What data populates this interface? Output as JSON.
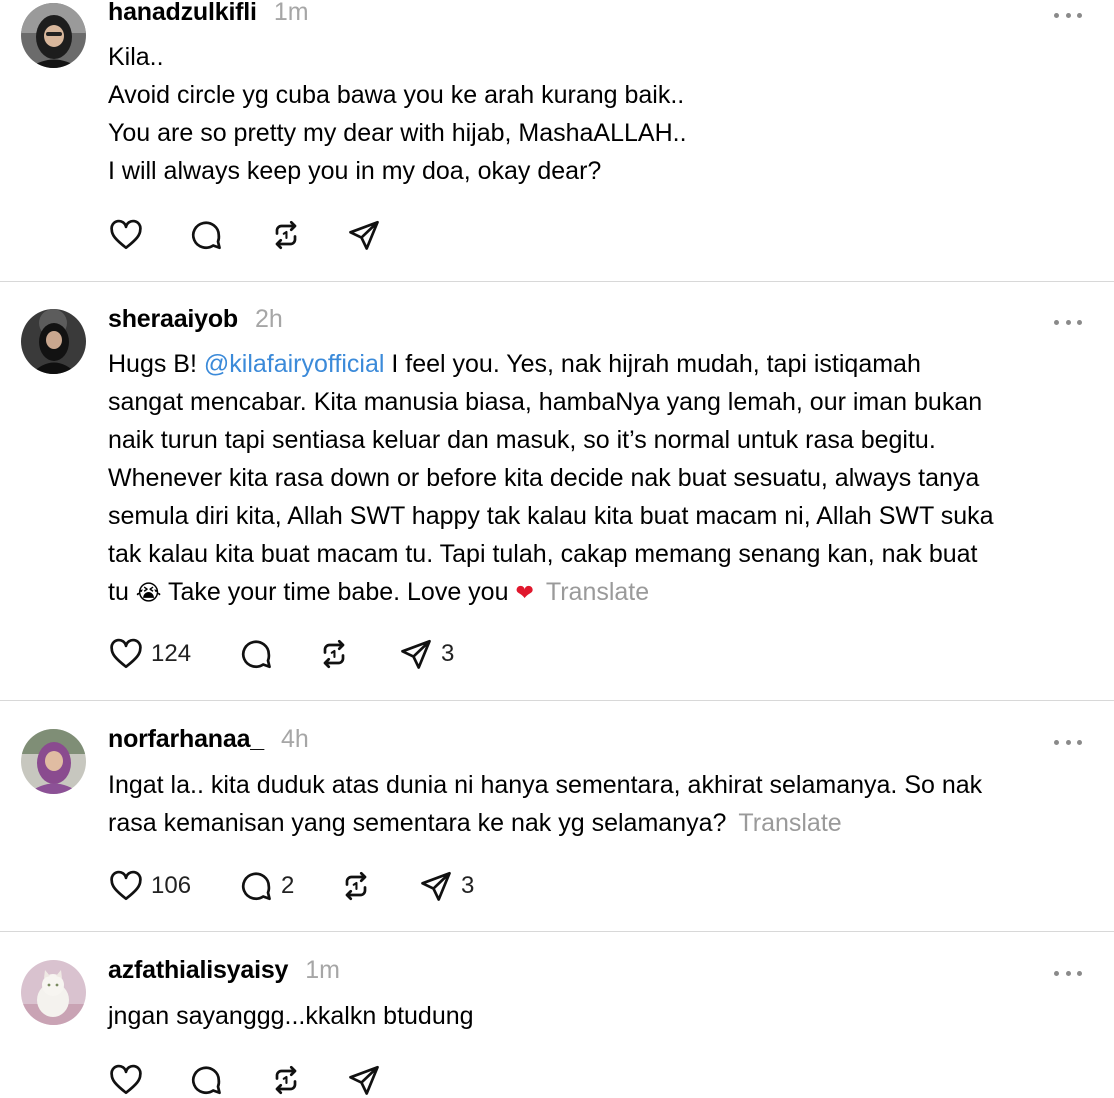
{
  "posts": [
    {
      "username": "hanadzulkifli",
      "time": "1m",
      "lines": [
        "Kila..",
        "Avoid circle yg cuba bawa you ke arah kurang baik..",
        "You are so pretty my dear with hijab, MashaALLAH..",
        "I will always keep you in my doa, okay dear?"
      ],
      "likes": "",
      "replies": "",
      "reposts": "",
      "shares": ""
    },
    {
      "username": "sheraaiyob",
      "time": "2h",
      "mention": "@kilafairyofficial",
      "line1_start": "Hugs B!",
      "line1_end": " I feel you. Yes, nak hijrah mudah, tapi istiqamah",
      "lines": [
        "sangat mencabar. Kita manusia biasa, hambaNya yang lemah, our iman bukan",
        "naik turun tapi sentiasa keluar dan masuk, so it’s normal untuk rasa begitu.",
        "Whenever kita rasa down or before kita decide nak buat sesuatu, always tanya",
        "semula diri kita, Allah SWT happy tak kalau kita buat macam ni, Allah SWT suka",
        "tak kalau kita buat macam tu. Tapi tulah, cakap memang senang kan, nak buat"
      ],
      "last_a": "tu ",
      "emoji_cry": "😭",
      "last_b": " Take your time babe. Love you ",
      "emoji_heart": "❤",
      "translate": "Translate",
      "likes": "124",
      "replies": "",
      "reposts": "",
      "shares": "3"
    },
    {
      "username": "norfarhanaa_",
      "time": "4h",
      "lines": [
        "Ingat la.. kita duduk atas dunia ni hanya sementara, akhirat selamanya. So nak"
      ],
      "last_text": "rasa kemanisan yang sementara ke nak yg selamanya?",
      "translate": "Translate",
      "likes": "106",
      "replies": "2",
      "reposts": "",
      "shares": "3"
    },
    {
      "username": "azfathialisyaisy",
      "time": "1m",
      "lines": [
        "jngan sayanggg...kkalkn btudung"
      ],
      "likes": "",
      "replies": "",
      "reposts": "",
      "shares": ""
    }
  ],
  "icons": {
    "like": "heart-icon",
    "reply": "comment-bubble-icon",
    "repost": "repost-icon",
    "share": "send-icon",
    "more": "more-dots-icon"
  },
  "colors": {
    "mention": "#3b8ad9",
    "muted": "#a6a6a6",
    "divider": "#d8d8d8"
  }
}
